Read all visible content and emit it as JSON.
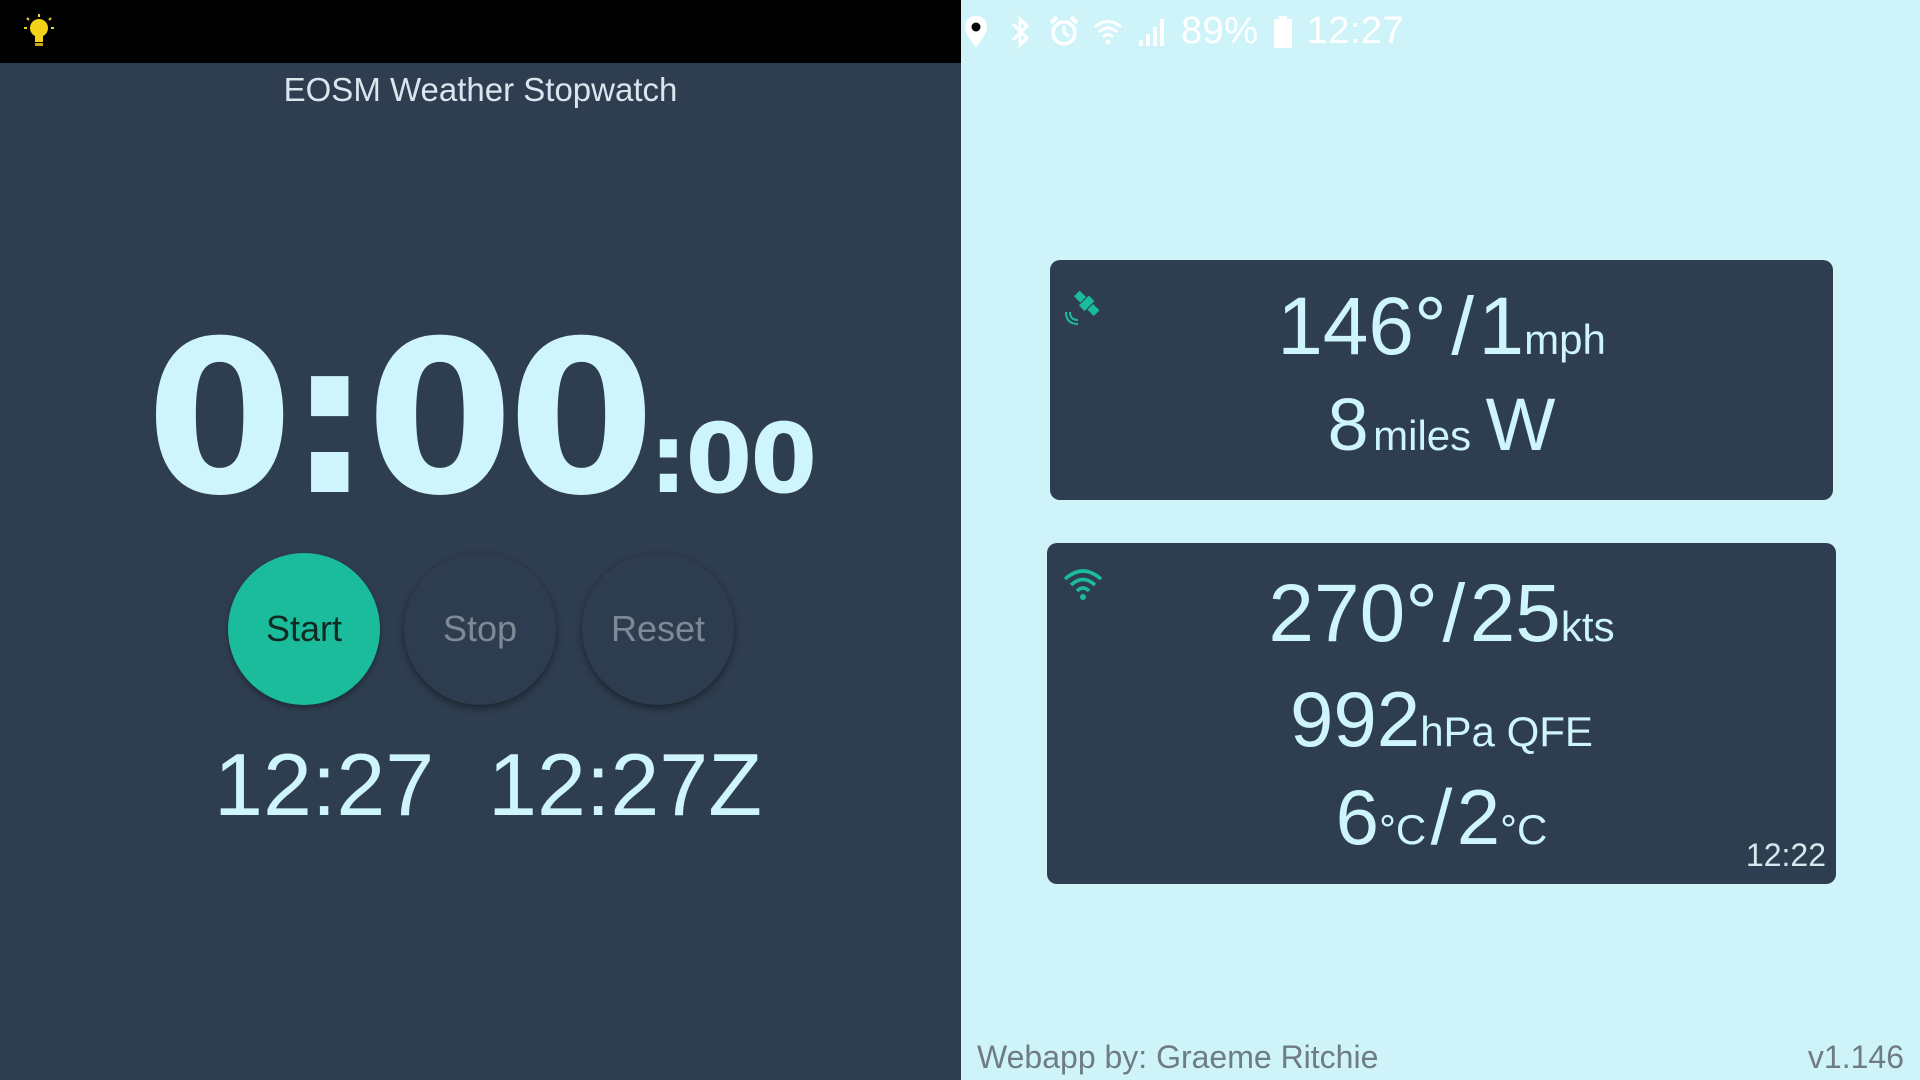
{
  "status_bar": {
    "left_icon": "lightbulb-icon",
    "icons": [
      "location-icon",
      "bluetooth-icon",
      "alarm-icon",
      "wifi-icon",
      "signal-icon"
    ],
    "battery_percent": "89%",
    "time": "12:27"
  },
  "app": {
    "title": "EOSM Weather Stopwatch"
  },
  "stopwatch": {
    "main": "0:00",
    "seconds": ":00"
  },
  "buttons": {
    "start": "Start",
    "stop": "Stop",
    "reset": "Reset"
  },
  "clocks": {
    "local": "12:27",
    "zulu": "12:27Z"
  },
  "gps_card": {
    "icon": "satellite-icon",
    "wind_direction": "146°",
    "separator": "/",
    "wind_speed": "1",
    "wind_unit": "mph",
    "distance": "8",
    "distance_unit": "miles",
    "bearing": "W"
  },
  "station_card": {
    "icon": "wifi-signal-icon",
    "wind_direction": "270°",
    "separator": "/",
    "wind_speed": "25",
    "wind_unit": "kts",
    "pressure": "992",
    "pressure_unit": "hPa QFE",
    "temperature": "6",
    "temperature_unit": "°C",
    "dewpoint": "2",
    "dewpoint_unit": "°C",
    "updated": "12:22"
  },
  "footer": {
    "credit": "Webapp by: Graeme Ritchie",
    "version": "v1.146"
  },
  "colors": {
    "dark_panel": "#2e3e50",
    "light_panel": "#cef4fa",
    "accent": "#1abc9c",
    "value_text": "#cdf5fb"
  }
}
